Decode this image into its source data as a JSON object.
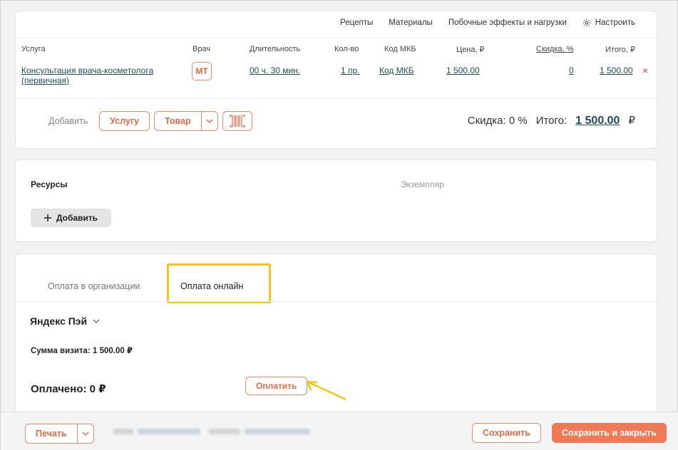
{
  "services": {
    "links": {
      "recipes": "Рецепты",
      "materials": "Материалы",
      "side_effects": "Побочные эффекты и нагрузки",
      "settings": "Настроить"
    },
    "headers": {
      "service": "Услуга",
      "doctor": "Врач",
      "duration": "Длительность",
      "qty": "Кол-во",
      "icd": "Код МКБ",
      "price": "Цена, ₽",
      "discount": "Скидка, %",
      "total": "Итого, ₽"
    },
    "row": {
      "name": "Консультация врача-косметолога (первичная)",
      "doctor_initials": "МТ",
      "duration": "00 ч. 30 мин.",
      "qty": "1 пр.",
      "icd": "Код МКБ",
      "price": "1 500.00",
      "discount": "0",
      "total": "1 500.00",
      "delete_symbol": "×"
    },
    "add": {
      "label": "Добавить",
      "service_btn": "Услугу",
      "product_btn": "Товар"
    },
    "summary": {
      "discount_text": "Скидка: 0 %",
      "total_label": "Итого:",
      "total_value": "1 500.00",
      "currency": "₽"
    }
  },
  "resources": {
    "title": "Ресурсы",
    "instance": "Экземпляр",
    "add_btn": "Добавить"
  },
  "payment": {
    "tab_org": "Оплата в организации",
    "tab_online": "Оплата онлайн",
    "provider": "Яндекс Пэй",
    "visit_sum": "Сумма визита: 1 500.00 ₽",
    "paid": "Оплачено: 0 ₽",
    "pay_btn": "Оплатить",
    "highlight_color": "#f5c518"
  },
  "footer": {
    "print_btn": "Печать",
    "save_btn": "Сохранить",
    "save_close_btn": "Сохранить и закрыть"
  },
  "colors": {
    "accent": "#ef7a55",
    "link": "#1e4e59",
    "danger": "#e04040"
  }
}
